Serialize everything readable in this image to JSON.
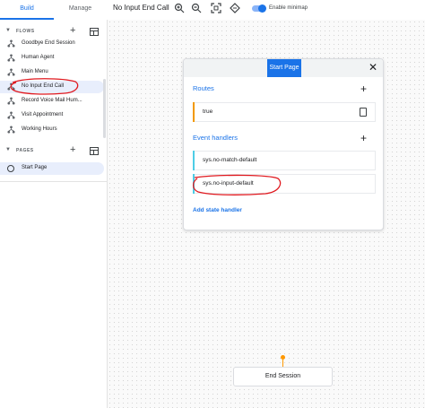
{
  "sidebar": {
    "tabs": {
      "build": "Build",
      "manage": "Manage"
    },
    "flows_heading": "FLOWS",
    "flows": [
      {
        "label": "Goodbye End Session"
      },
      {
        "label": "Human Agent"
      },
      {
        "label": "Main Menu"
      },
      {
        "label": "No Input End Call",
        "selected": true
      },
      {
        "label": "Record Voice Mail Hum..."
      },
      {
        "label": "Visit Appointment"
      },
      {
        "label": "Working Hours"
      }
    ],
    "pages_heading": "PAGES",
    "pages": [
      {
        "label": "Start Page",
        "selected": true
      }
    ]
  },
  "toolbar": {
    "flow_name": "No Input End Call",
    "minimap_label": "Enable minimap",
    "minimap_enabled": true,
    "icons": [
      "zoom-in-icon",
      "zoom-out-icon",
      "fit-screen-icon",
      "reset-view-icon"
    ]
  },
  "page_card": {
    "title": "Start Page",
    "routes_label": "Routes",
    "routes": [
      {
        "label": "true",
        "accent": "#f29900"
      }
    ],
    "event_handlers_label": "Event handlers",
    "event_handlers": [
      {
        "label": "sys.no-match-default",
        "accent": "#4ecde6"
      },
      {
        "label": "sys.no-input-default",
        "accent": "#4ecde6"
      }
    ],
    "add_state_handler_label": "Add state handler"
  },
  "end_session": {
    "label": "End Session"
  },
  "colors": {
    "accent_blue": "#1a73e8",
    "selected_bg": "#e8eefc",
    "annotation_red": "#e0191f",
    "connector_orange": "#ff9800"
  }
}
